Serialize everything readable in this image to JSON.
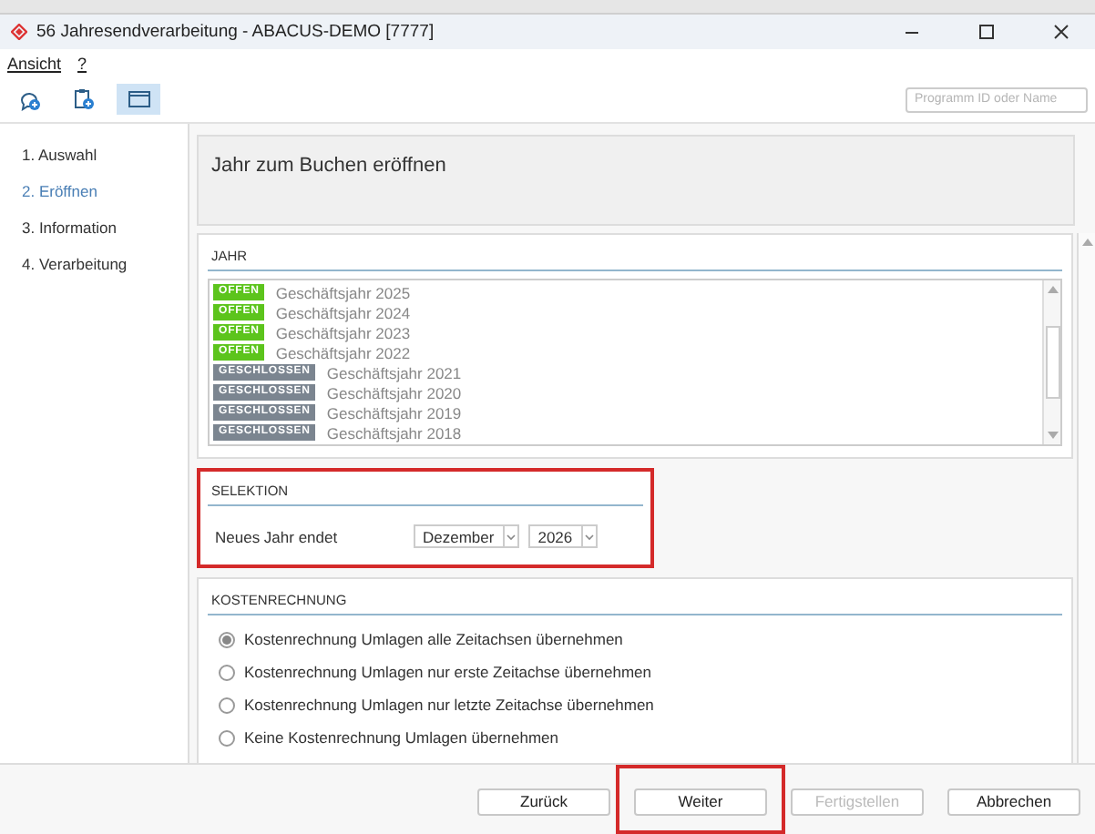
{
  "window": {
    "title": "56 Jahresendverarbeitung - ABACUS-DEMO [7777]"
  },
  "menu": [
    {
      "label": "Ansicht"
    },
    {
      "label": "?"
    }
  ],
  "toolbar": {
    "buttons": [
      {
        "kind": "chat",
        "selected": false
      },
      {
        "kind": "clipboard",
        "selected": false
      },
      {
        "kind": "window",
        "selected": true
      }
    ],
    "search": {
      "placeholder": "Programm ID oder Name"
    }
  },
  "steps": [
    {
      "label": "1. Auswahl",
      "selected": false
    },
    {
      "label": "2. Eröffnen",
      "selected": true
    },
    {
      "label": "3. Information",
      "selected": false
    },
    {
      "label": "4. Verarbeitung",
      "selected": false
    }
  ],
  "header": {
    "title": "Jahr zum Buchen eröffnen"
  },
  "jahr": {
    "title": "JAHR",
    "rows": [
      {
        "status": "OFFEN",
        "kind": "open",
        "label": "Geschäftsjahr 2025"
      },
      {
        "status": "OFFEN",
        "kind": "open",
        "label": "Geschäftsjahr 2024"
      },
      {
        "status": "OFFEN",
        "kind": "open",
        "label": "Geschäftsjahr 2023"
      },
      {
        "status": "OFFEN",
        "kind": "open",
        "label": "Geschäftsjahr 2022"
      },
      {
        "status": "GESCHLOSSEN",
        "kind": "closed",
        "label": "Geschäftsjahr 2021"
      },
      {
        "status": "GESCHLOSSEN",
        "kind": "closed",
        "label": "Geschäftsjahr 2020"
      },
      {
        "status": "GESCHLOSSEN",
        "kind": "closed",
        "label": "Geschäftsjahr 2019"
      },
      {
        "status": "GESCHLOSSEN",
        "kind": "closed",
        "label": "Geschäftsjahr 2018"
      }
    ]
  },
  "selektion": {
    "title": "SELEKTION",
    "highlighted": true,
    "label": "Neues Jahr endet",
    "month": "Dezember",
    "year": "2026"
  },
  "kostenrechnung": {
    "title": "KOSTENRECHNUNG",
    "options": [
      {
        "label": "Kostenrechnung Umlagen alle Zeitachsen übernehmen",
        "selected": true
      },
      {
        "label": "Kostenrechnung Umlagen nur erste Zeitachse übernehmen",
        "selected": false
      },
      {
        "label": "Kostenrechnung Umlagen nur letzte Zeitachse übernehmen",
        "selected": false
      },
      {
        "label": "Keine Kostenrechnung Umlagen übernehmen",
        "selected": false
      }
    ]
  },
  "buttons": [
    {
      "label": "Zurück",
      "disabled": false,
      "highlighted": false
    },
    {
      "label": "Weiter",
      "disabled": false,
      "highlighted": true
    },
    {
      "label": "Fertigstellen",
      "disabled": true,
      "highlighted": false
    },
    {
      "label": "Abbrechen",
      "disabled": false,
      "highlighted": false
    }
  ]
}
